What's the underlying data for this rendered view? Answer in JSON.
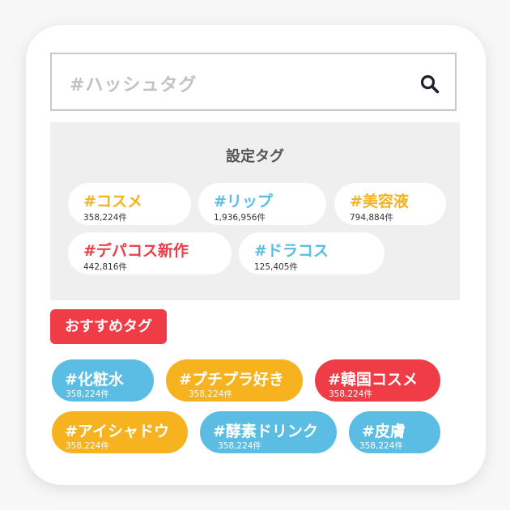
{
  "search": {
    "placeholder": "#ハッシュタグ",
    "icon": "search-icon"
  },
  "settings": {
    "title": "設定タグ",
    "tags": [
      {
        "name": "#コスメ",
        "count": "358,224件",
        "color": "#f6b21f"
      },
      {
        "name": "#リップ",
        "count": "1,936,956件",
        "color": "#5bbde3"
      },
      {
        "name": "#美容液",
        "count": "794,884件",
        "color": "#f6b21f"
      },
      {
        "name": "#デパコス新作",
        "count": "442,816件",
        "color": "#f03c46"
      },
      {
        "name": "#ドラコス",
        "count": "125,405件",
        "color": "#5bbde3"
      }
    ]
  },
  "recommended": {
    "label": "おすすめタグ",
    "tags": [
      {
        "name": "#化粧水",
        "count": "358,224件",
        "color": "#5bbde3"
      },
      {
        "name": "#プチプラ好き",
        "count": "358,224件",
        "color": "#f6b21f"
      },
      {
        "name": "#韓国コスメ",
        "count": "358,224件",
        "color": "#f03c46"
      },
      {
        "name": "#アイシャドウ",
        "count": "358,224件",
        "color": "#f6b21f"
      },
      {
        "name": "#酵素ドリンク",
        "count": "358,224件",
        "color": "#5bbde3"
      },
      {
        "name": "#皮膚",
        "count": "358,224件",
        "color": "#5bbde3"
      }
    ]
  }
}
